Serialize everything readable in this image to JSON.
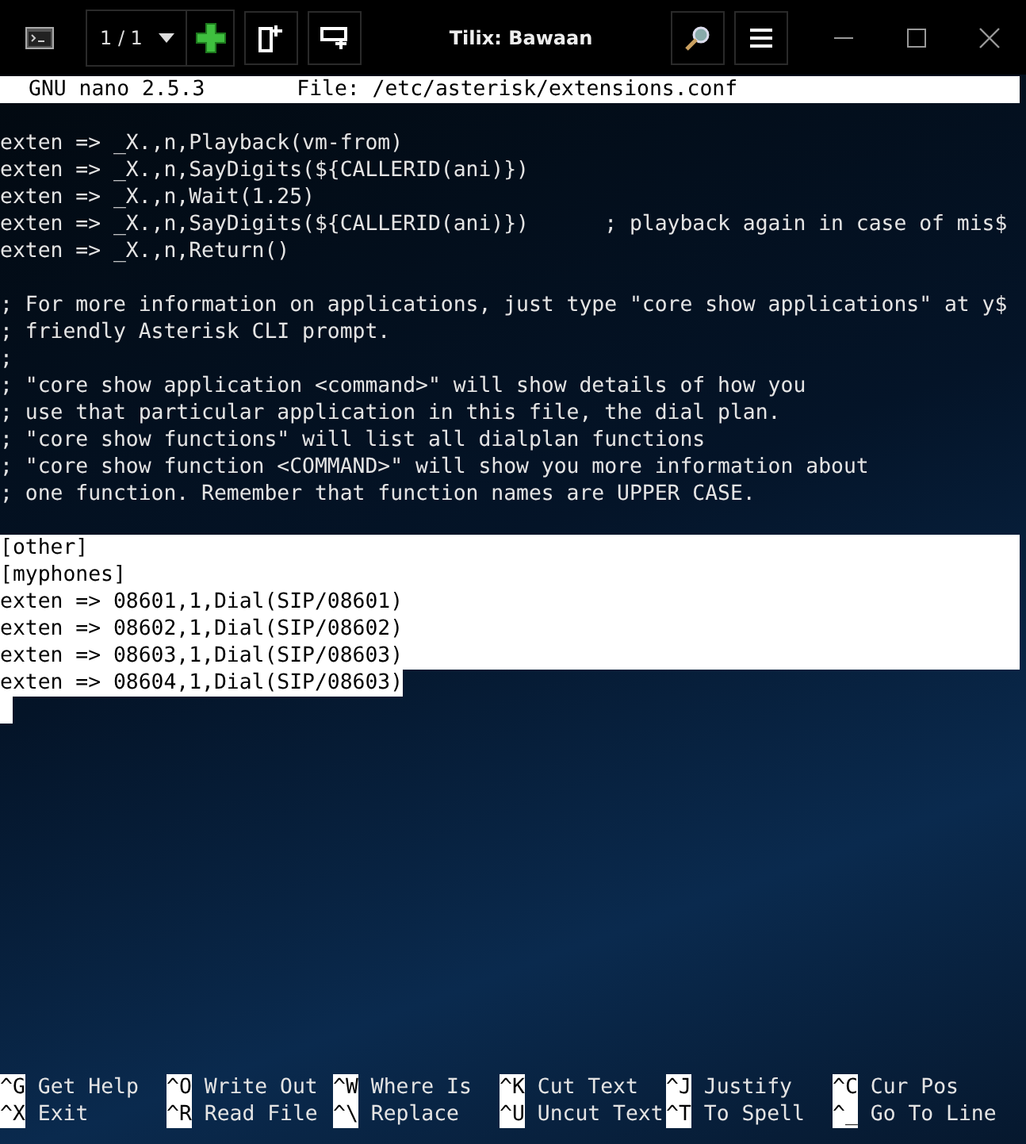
{
  "window": {
    "title": "Tilix: Bawaan",
    "session": "1 / 1"
  },
  "nano_header": {
    "version": "GNU nano 2.5.3",
    "file": "File: /etc/asterisk/extensions.conf"
  },
  "blocks": [
    {
      "lines": [
        {
          "text": "exten => _X.,n,Playback(vm-from)",
          "selected": false
        },
        {
          "text": "exten => _X.,n,SayDigits(${CALLERID(ani)})",
          "selected": false
        },
        {
          "text": "exten => _X.,n,Wait(1.25)",
          "selected": false
        },
        {
          "text": "exten => _X.,n,SayDigits(${CALLERID(ani)})      ; playback again in case of mis$",
          "selected": false
        },
        {
          "text": "exten => _X.,n,Return()",
          "selected": false
        }
      ]
    },
    {
      "lines": [
        {
          "text": "; For more information on applications, just type \"core show applications\" at y$",
          "selected": false
        },
        {
          "text": "; friendly Asterisk CLI prompt.",
          "selected": false
        },
        {
          "text": ";",
          "selected": false
        },
        {
          "text": "; \"core show application <command>\" will show details of how you",
          "selected": false
        },
        {
          "text": "; use that particular application in this file, the dial plan.",
          "selected": false
        },
        {
          "text": "; \"core show functions\" will list all dialplan functions",
          "selected": false
        },
        {
          "text": "; \"core show function <COMMAND>\" will show you more information about",
          "selected": false
        },
        {
          "text": "; one function. Remember that function names are UPPER CASE.",
          "selected": false
        }
      ]
    },
    {
      "lines": [
        {
          "text": "[other]",
          "selected": true
        },
        {
          "text": "[myphones]",
          "selected": true
        },
        {
          "text": "exten => 08601,1,Dial(SIP/08601)",
          "selected": true
        },
        {
          "text": "exten => 08602,1,Dial(SIP/08602)",
          "selected": true
        },
        {
          "text": "exten => 08603,1,Dial(SIP/08603)",
          "selected": true
        },
        {
          "text": "exten => 08604,1,Dial(SIP/08603)",
          "selected": true
        }
      ]
    }
  ],
  "shortcuts": [
    [
      {
        "key": "^G",
        "label": "Get Help"
      },
      {
        "key": "^O",
        "label": "Write Out"
      },
      {
        "key": "^W",
        "label": "Where Is"
      },
      {
        "key": "^K",
        "label": "Cut Text"
      },
      {
        "key": "^J",
        "label": "Justify"
      },
      {
        "key": "^C",
        "label": "Cur Pos"
      }
    ],
    [
      {
        "key": "^X",
        "label": "Exit"
      },
      {
        "key": "^R",
        "label": "Read File"
      },
      {
        "key": "^\\",
        "label": "Replace"
      },
      {
        "key": "^U",
        "label": "Uncut Text"
      },
      {
        "key": "^T",
        "label": "To Spell"
      },
      {
        "key": "^_",
        "label": "Go To Line"
      }
    ]
  ]
}
